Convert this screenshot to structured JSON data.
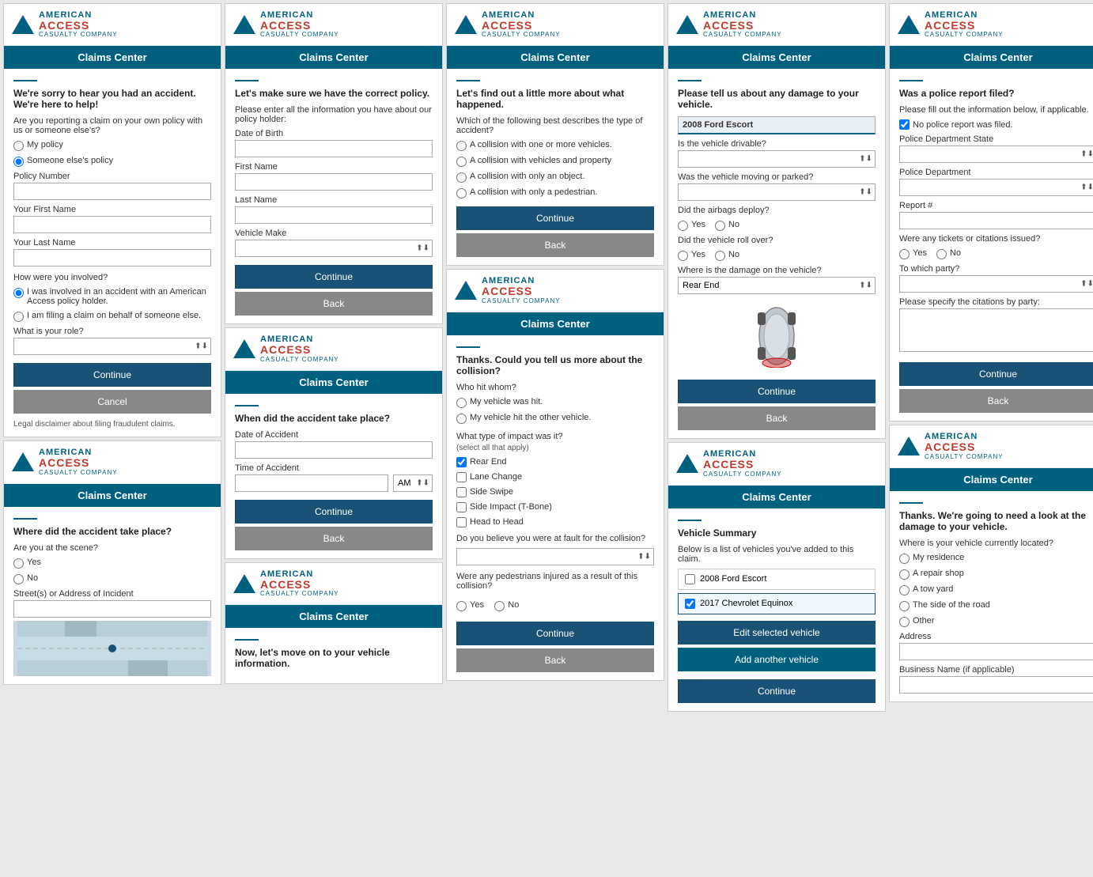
{
  "brand": {
    "american": "AMERICAN",
    "access": "ACCESS",
    "casualty": "CASUALTY COMPANY"
  },
  "claims_center": "Claims Center",
  "col1": {
    "panel1": {
      "title": "We're sorry to hear you had an accident. We're here to help!",
      "question1": "Are you reporting a claim on your own policy with us or someone else's?",
      "options_policy": [
        "My policy",
        "Someone else's policy"
      ],
      "selected_policy": "Someone else's policy",
      "policy_number_label": "Policy Number",
      "first_name_label": "Your First Name",
      "last_name_label": "Your Last Name",
      "question2": "How were you involved?",
      "options_involved": [
        "I was involved in an accident with an American Access policy holder.",
        "I am filing a claim on behalf of someone else."
      ],
      "selected_involved": 0,
      "role_label": "What is your role?",
      "btn_continue": "Continue",
      "btn_cancel": "Cancel",
      "disclaimer": "Legal disclaimer about filing fraudulent claims."
    },
    "panel2": {
      "title": "Where did the accident take place?",
      "question": "Are you at the scene?",
      "options_scene": [
        "Yes",
        "No"
      ],
      "address_label": "Street(s) or Address of Incident"
    }
  },
  "col2": {
    "panel1": {
      "title": "Let's make sure we have the correct policy.",
      "subtitle": "Please enter all the information you have about our policy holder:",
      "dob_label": "Date of Birth",
      "first_name_label": "First Name",
      "last_name_label": "Last Name",
      "vehicle_make_label": "Vehicle Make",
      "btn_continue": "Continue",
      "btn_back": "Back"
    },
    "panel2": {
      "title": "When did the accident take place?",
      "date_label": "Date of Accident",
      "time_label": "Time of Accident",
      "am_pm": "AM",
      "btn_continue": "Continue",
      "btn_back": "Back"
    },
    "panel3": {
      "title": "Now, let's move on to your vehicle information."
    }
  },
  "col3": {
    "panel1": {
      "title": "Let's find out a little more about what happened.",
      "question": "Which of the following best describes the type of accident?",
      "options": [
        "A collision with one or more vehicles.",
        "A collision with vehicles and property",
        "A collision with only an object.",
        "A collision with only a pedestrian."
      ],
      "btn_continue": "Continue",
      "btn_back": "Back"
    },
    "panel2": {
      "title": "Thanks. Could you tell us more about the collision?",
      "who_hit_whom_label": "Who hit whom?",
      "options_who": [
        "My vehicle was hit.",
        "My vehicle hit the other vehicle."
      ],
      "impact_label": "What type of impact was it?",
      "impact_note": "(select all that apply)",
      "impact_options": [
        "Rear End",
        "Lane Change",
        "Side Swipe",
        "Side Impact (T-Bone)",
        "Head to Head"
      ],
      "checked_impacts": [
        0
      ],
      "fault_label": "Do you believe you were at fault for the collision?",
      "pedestrians_label": "Were any pedestrians injured as a result of this collision?",
      "options_ped": [
        "Yes",
        "No"
      ],
      "btn_continue": "Continue",
      "btn_back": "Back"
    }
  },
  "col4": {
    "panel1": {
      "title": "Please tell us about any damage to your vehicle.",
      "vehicle_name": "2008 Ford Escort",
      "drivable_label": "Is the vehicle drivable?",
      "moving_label": "Was the vehicle moving or parked?",
      "airbags_label": "Did the airbags deploy?",
      "options_airbags": [
        "Yes",
        "No"
      ],
      "rollover_label": "Did the vehicle roll over?",
      "options_rollover": [
        "Yes",
        "No"
      ],
      "damage_label": "Where is the damage on the vehicle?",
      "selected_damage": "Rear End",
      "btn_continue": "Continue",
      "btn_back": "Back"
    },
    "panel2": {
      "title": "Vehicle Summary",
      "subtitle": "Below is a list of vehicles you've added to this claim.",
      "vehicles": [
        {
          "name": "2008 Ford Escort",
          "checked": false
        },
        {
          "name": "2017 Chevrolet Equinox",
          "checked": true
        }
      ],
      "btn_edit": "Edit selected vehicle",
      "btn_add": "Add another vehicle",
      "btn_continue": "Continue"
    }
  },
  "col5": {
    "panel1": {
      "title": "Was a police report filed?",
      "subtitle": "Please fill out the information below, if applicable.",
      "no_report_label": "No police report was filed.",
      "no_report_checked": true,
      "dept_state_label": "Police Department State",
      "dept_label": "Police Department",
      "report_num_label": "Report #",
      "tickets_label": "Were any tickets or citations issued?",
      "options_tickets": [
        "Yes",
        "No"
      ],
      "which_party_label": "To which party?",
      "citations_label": "Please specify the citations by party:",
      "btn_continue": "Continue",
      "btn_back": "Back"
    },
    "panel2": {
      "title": "Thanks. We're going to need a look at the damage to your vehicle.",
      "location_label": "Where is your vehicle currently located?",
      "options_location": [
        "My residence",
        "A repair shop",
        "A tow yard",
        "The side of the road",
        "Other"
      ],
      "address_label": "Address",
      "business_label": "Business Name (if applicable)"
    }
  }
}
